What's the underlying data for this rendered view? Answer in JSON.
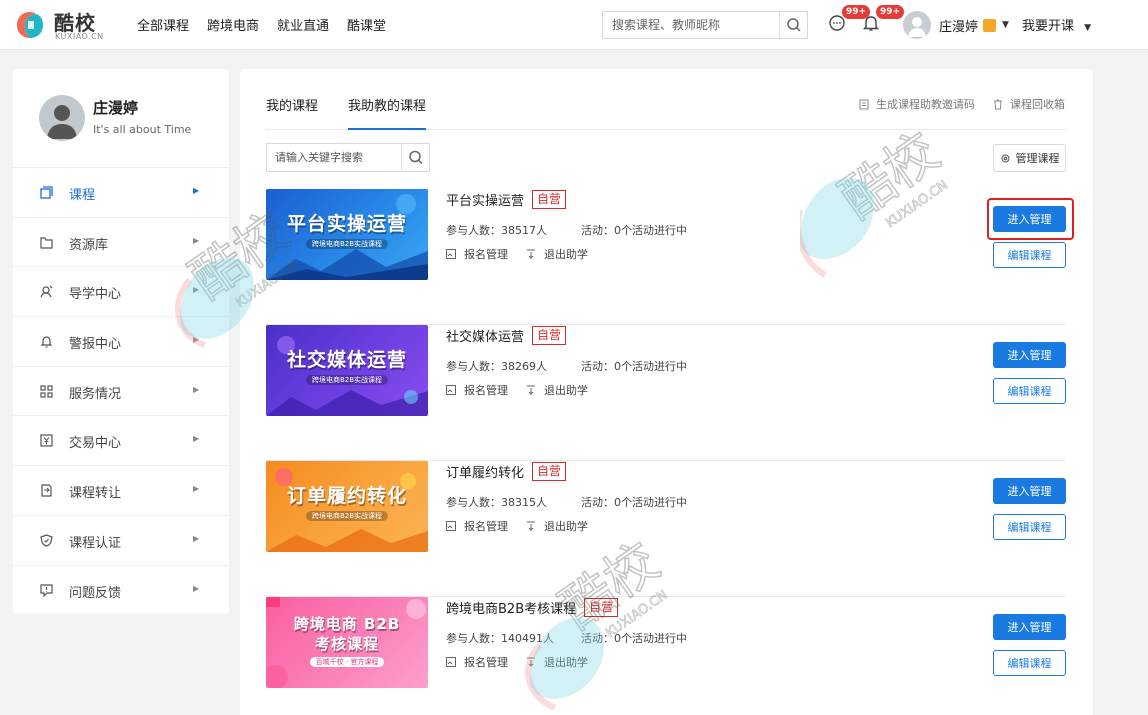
{
  "header": {
    "logo_text": "酷校",
    "logo_sub": "KUXIAO.CN",
    "nav": [
      "全部课程",
      "跨境电商",
      "就业直通",
      "酷课堂"
    ],
    "search_placeholder": "搜索课程、教师昵称",
    "msg_badge": "99+",
    "notice_badge": "99+",
    "user_name": "庄漫婷",
    "open_course": "我要开课"
  },
  "sidebar": {
    "name": "庄漫婷",
    "motto": "It's all about Time",
    "items": [
      {
        "label": "课程",
        "icon": "course-icon"
      },
      {
        "label": "资源库",
        "icon": "folder-icon"
      },
      {
        "label": "导学中心",
        "icon": "guide-icon"
      },
      {
        "label": "警报中心",
        "icon": "bell-icon"
      },
      {
        "label": "服务情况",
        "icon": "grid-icon"
      },
      {
        "label": "交易中心",
        "icon": "yen-icon"
      },
      {
        "label": "课程转让",
        "icon": "transfer-icon"
      },
      {
        "label": "课程认证",
        "icon": "shield-icon"
      },
      {
        "label": "问题反馈",
        "icon": "feedback-icon"
      }
    ]
  },
  "main": {
    "tabs": [
      "我的课程",
      "我助教的课程"
    ],
    "tool_invite": "生成课程助教邀请码",
    "tool_recycle": "课程回收箱",
    "kw_placeholder": "请输入关键字搜索",
    "manage_course": "管理课程",
    "enter_label": "进入管理",
    "edit_label": "编辑课程",
    "signup_label": "报名管理",
    "quit_label": "退出助学",
    "courses": [
      {
        "title": "平台实操运营",
        "tag": "自营",
        "participants": "参与人数：38517人",
        "activity": "活动：0个活动进行中",
        "thumb_title": "平台实操运营",
        "thumb_sub": "跨境电商B2B实战课程"
      },
      {
        "title": "社交媒体运营",
        "tag": "自营",
        "participants": "参与人数：38269人",
        "activity": "活动：0个活动进行中",
        "thumb_title": "社交媒体运营",
        "thumb_sub": "跨境电商B2B实战课程"
      },
      {
        "title": "订单履约转化",
        "tag": "自营",
        "participants": "参与人数：38315人",
        "activity": "活动：0个活动进行中",
        "thumb_title": "订单履约转化",
        "thumb_sub": "跨境电商B2B实战课程"
      },
      {
        "title": "跨境电商B2B考核课程",
        "tag": "自营",
        "participants": "参与人数：140491人",
        "activity": "活动：0个活动进行中",
        "thumb_title": "跨境电商 B2B",
        "thumb_title2": "考核课程",
        "thumb_sub": "百城千校 · 官方课程"
      }
    ]
  },
  "watermark": {
    "text": "酷校",
    "sub": "KUXIAO.CN"
  },
  "colors": {
    "accent": "#1a7ae0",
    "tag_red": "#d42b2b",
    "badge": "#e43b3b"
  }
}
